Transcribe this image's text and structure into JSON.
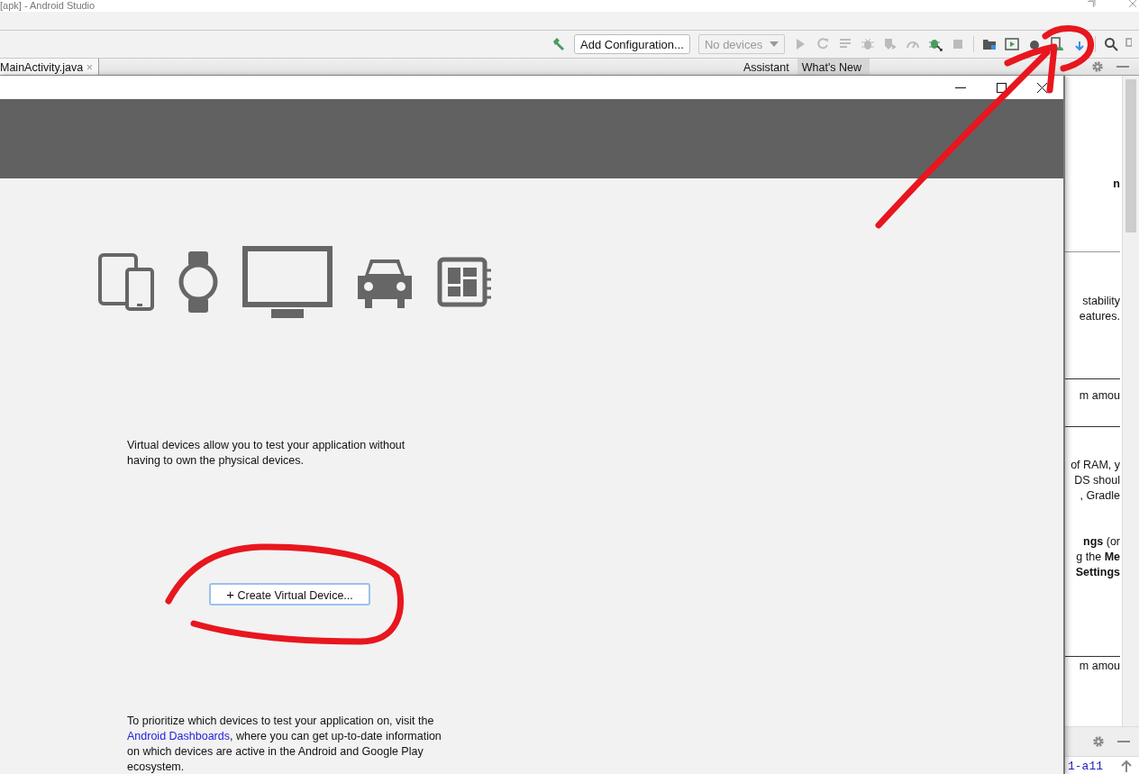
{
  "window": {
    "title": "[apk] - Android Studio"
  },
  "toolbar": {
    "configuration": "Add Configuration...",
    "devices": {
      "value": "No devices",
      "disabled": true
    }
  },
  "editor_tabs": [
    {
      "label": "MainActivity.java",
      "close": "×",
      "selected": true
    }
  ],
  "side_tabs": [
    {
      "label": "Assistant",
      "selected": false
    },
    {
      "label": "What's New",
      "selected": true
    }
  ],
  "dialog": {
    "intro": "Virtual devices allow you to test your application without having to own the physical devices.",
    "create_button": {
      "icon": "+",
      "label": "Create Virtual Device..."
    },
    "footer": {
      "before": "To prioritize which devices to test your application on, visit the ",
      "link": "Android Dashboards",
      "after": ", where you can get up-to-date information on which devices are active in the Android and Google Play ecosystem."
    }
  },
  "assistant_panel": {
    "blocks": [
      {
        "rule": false,
        "lines": [
          "**n**"
        ]
      },
      {
        "rule": true,
        "lines": [
          "stability",
          "eatures."
        ]
      },
      {
        "rule": true,
        "lines": [
          "m amou"
        ]
      },
      {
        "rule": true,
        "lines": [
          "of RAM, y",
          "DS shoul",
          ", Gradle"
        ]
      },
      {
        "rule": false,
        "lines": [
          "**ngs** (or",
          "g the **Me**",
          "**Settings**"
        ]
      },
      {
        "rule": true,
        "lines": [
          "m amou"
        ]
      }
    ],
    "console_text": "1-a11"
  }
}
